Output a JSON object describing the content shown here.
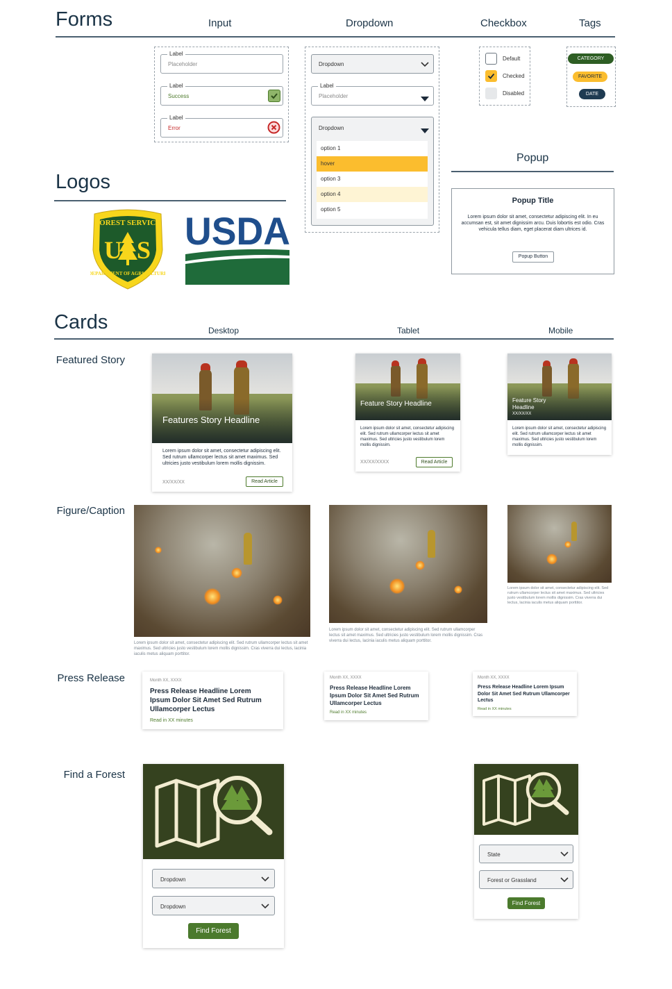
{
  "sections": {
    "forms": "Forms",
    "logos": "Logos",
    "cards": "Cards",
    "popup": "Popup"
  },
  "forms_columns": {
    "input": "Input",
    "dropdown": "Dropdown",
    "checkbox": "Checkbox",
    "tags": "Tags"
  },
  "inputs": [
    {
      "label": "Label",
      "value": "Placeholder",
      "state": "default"
    },
    {
      "label": "Label",
      "value": "Success",
      "state": "success"
    },
    {
      "label": "Label",
      "value": "Error",
      "state": "error"
    }
  ],
  "dropdowns": {
    "closed": "Dropdown",
    "labeled": {
      "label": "Label",
      "placeholder": "Placeholder"
    },
    "open": {
      "label": "Dropdown",
      "options": [
        "option 1",
        "hover",
        "option 3",
        "option 4",
        "option 5"
      ]
    }
  },
  "checkboxes": [
    {
      "label": "Default",
      "state": "default"
    },
    {
      "label": "Checked",
      "state": "checked"
    },
    {
      "label": "Disabled",
      "state": "disabled"
    }
  ],
  "tags": [
    {
      "label": "CATEGORY",
      "color": "#2e5e24"
    },
    {
      "label": "FAVORITE",
      "color": "#fbbd2e"
    },
    {
      "label": "DATE",
      "color": "#1f3b52"
    }
  ],
  "popup": {
    "title": "Popup Title",
    "body": "Lorem ipsum dolor sit amet, consectetur adipiscing elit. In eu accumsan est, sit amet dignissim arcu. Duis lobortis est odio. Cras vehicula tellus diam, eget placerat diam ultrices id.",
    "button": "Popup Button"
  },
  "logos": {
    "forest_service": {
      "top": "FOREST SERVICE",
      "center": "U S",
      "bottom": "DEPARTMENT OF AGRICULTURE"
    },
    "usda": "USDA"
  },
  "cards_columns": {
    "desktop": "Desktop",
    "tablet": "Tablet",
    "mobile": "Mobile"
  },
  "rows": {
    "featured": "Featured Story",
    "figure": "Figure/Caption",
    "press": "Press Release",
    "find": "Find a Forest"
  },
  "featured": {
    "desktop": {
      "headline": "Features Story Headline",
      "body": "Lorem ipsum dolor sit amet, consectetur adipiscing elit. Sed rutrum ullamcorper lectus sit amet maximus. Sed ultricies justo vestibulum lorem mollis dignissim.",
      "date": "XX/XX/XX",
      "button": "Read Article"
    },
    "tablet": {
      "headline": "Feature Story Headline",
      "body": "Lorem ipsum dolor sit amet, consectetur adipiscing elit. Sed rutrum ullamcorper lectus sit amet maximus. Sed ultricies justo vestibulum lorem mollis dignissim.",
      "date": "XX/XX/XXXX",
      "button": "Read Article"
    },
    "mobile": {
      "headline": "Feature Story Headline",
      "date": "XX/XX/XX",
      "body": "Lorem ipsum dolor sit amet, consectetur adipiscing elit. Sed rutrum ullamcorper lectus sit amet maximus. Sed ultricies justo vestibulum lorem mollis dignissim."
    }
  },
  "figure": {
    "desktop": "Lorem ipsum dolor sit amet, consectetur adipiscing elit. Sed rutrum ullamcorper lectus sit amet maximus. Sed ultricies justo vestibulum lorem mollis dignissim. Cras viverra dui lectus, lacinia iaculis metus aliquam porttitor.",
    "tablet": "Lorem ipsum dolor sit amet, consectetur adipiscing elit. Sed rutrum ullamcorper lectus sit amet maximus. Sed ultricies justo vestibulum lorem mollis dignissim. Cras viverra dui lectus, lacinia iaculis metus aliquam porttitor.",
    "mobile": "Lorem ipsum dolor sit amet, consectetur adipiscing elit. Sed rutrum ullamcorper lectus sit amet maximus. Sed ultricies justo vestibulum lorem mollis dignissim. Cras viverra dui lectus, lacinia iaculis metus aliquam porttitor."
  },
  "press": {
    "desktop": {
      "date": "Month XX, XXXX",
      "title": "Press Release Headline Lorem Ipsum Dolor Sit Amet Sed Rutrum Ullamcorper Lectus",
      "read": "Read in XX minutes"
    },
    "tablet": {
      "date": "Month XX, XXXX",
      "title": "Press Release Headline Lorem Ipsum Dolor Sit Amet Sed Rutrum Ullamcorper Lectus",
      "read": "Read in XX minutes"
    },
    "mobile": {
      "date": "Month XX, XXXX",
      "title": "Press Release Headline Lorem Ipsum Dolor Sit Amet Sed Rutrum Ullamcorper Lectus",
      "read": "Read in XX minutes"
    }
  },
  "find": {
    "desktop": {
      "dropdown1": "Dropdown",
      "dropdown2": "Dropdown",
      "button": "Find Forest"
    },
    "mobile": {
      "dropdown1": "State",
      "dropdown2": "Forest or Grassland",
      "button": "Find Forest"
    }
  },
  "colors": {
    "navy": "#1a3346",
    "forest_green": "#35421f",
    "button_green": "#4b7a2d",
    "yellow": "#fbbd2e",
    "error_red": "#c62828"
  }
}
